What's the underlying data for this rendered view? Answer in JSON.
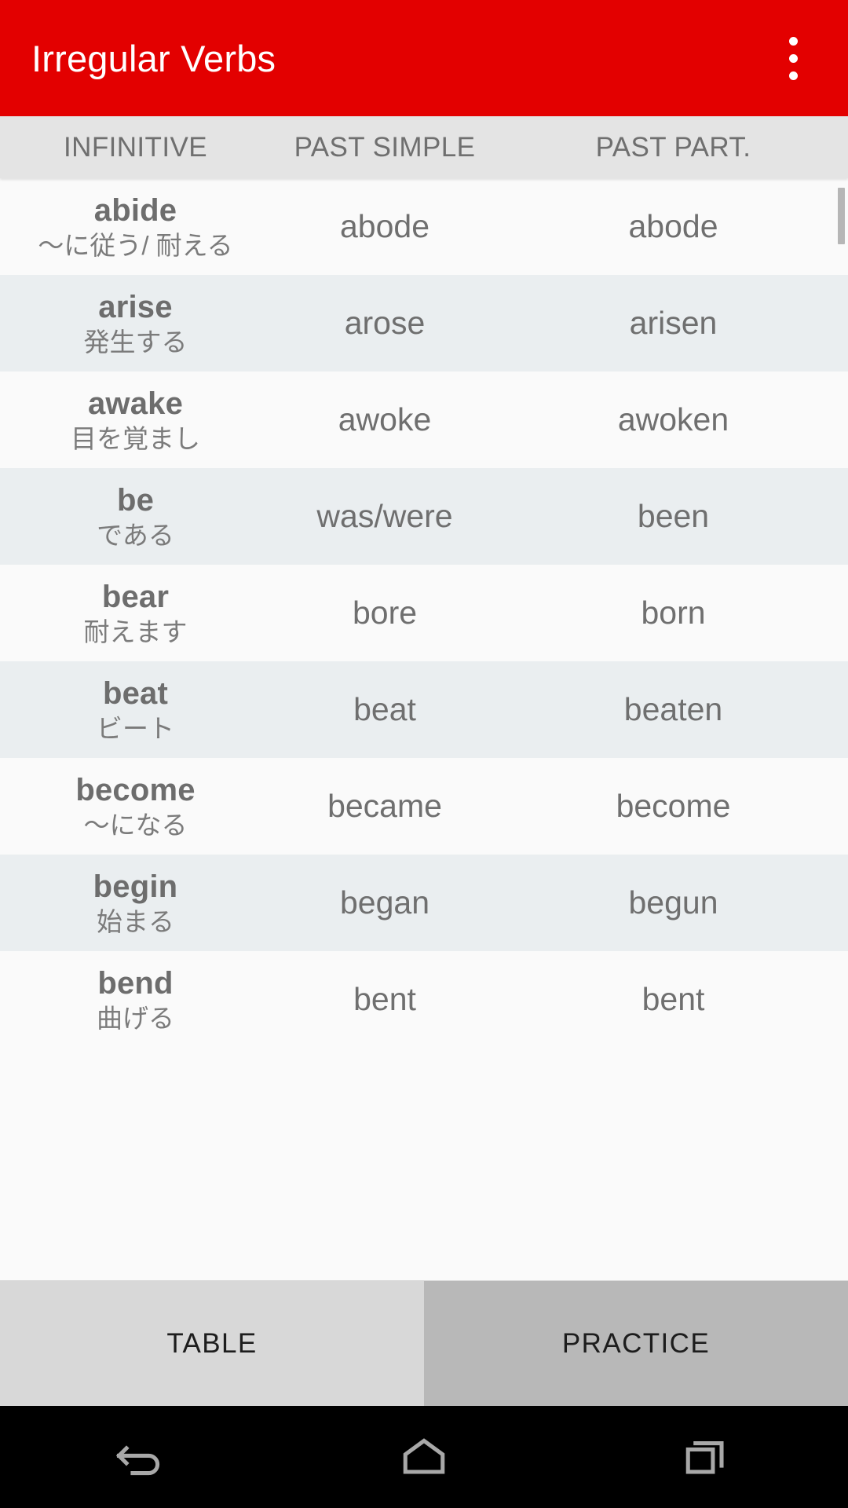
{
  "app": {
    "title": "Irregular Verbs",
    "accent_color": "#e30000",
    "overflow_icon": "more-vert-icon"
  },
  "table": {
    "headers": [
      "INFINITIVE",
      "PAST SIMPLE",
      "PAST PART."
    ],
    "rows": [
      {
        "infinitive": "abide",
        "meaning": "〜に従う/ 耐える",
        "past_simple": "abode",
        "past_participle": "abode"
      },
      {
        "infinitive": "arise",
        "meaning": "発生する",
        "past_simple": "arose",
        "past_participle": "arisen"
      },
      {
        "infinitive": "awake",
        "meaning": "目を覚まし",
        "past_simple": "awoke",
        "past_participle": "awoken"
      },
      {
        "infinitive": "be",
        "meaning": "である",
        "past_simple": "was/were",
        "past_participle": "been"
      },
      {
        "infinitive": "bear",
        "meaning": "耐えます",
        "past_simple": "bore",
        "past_participle": "born"
      },
      {
        "infinitive": "beat",
        "meaning": "ビート",
        "past_simple": "beat",
        "past_participle": "beaten"
      },
      {
        "infinitive": "become",
        "meaning": "〜になる",
        "past_simple": "became",
        "past_participle": "become"
      },
      {
        "infinitive": "begin",
        "meaning": "始まる",
        "past_simple": "began",
        "past_participle": "begun"
      },
      {
        "infinitive": "bend",
        "meaning": "曲げる",
        "past_simple": "bent",
        "past_participle": "bent"
      }
    ]
  },
  "tabs": {
    "items": [
      {
        "label": "TABLE",
        "selected": true
      },
      {
        "label": "PRACTICE",
        "selected": false
      }
    ]
  },
  "navbar": {
    "buttons": [
      {
        "name": "back-icon"
      },
      {
        "name": "home-icon"
      },
      {
        "name": "recents-icon"
      }
    ]
  }
}
